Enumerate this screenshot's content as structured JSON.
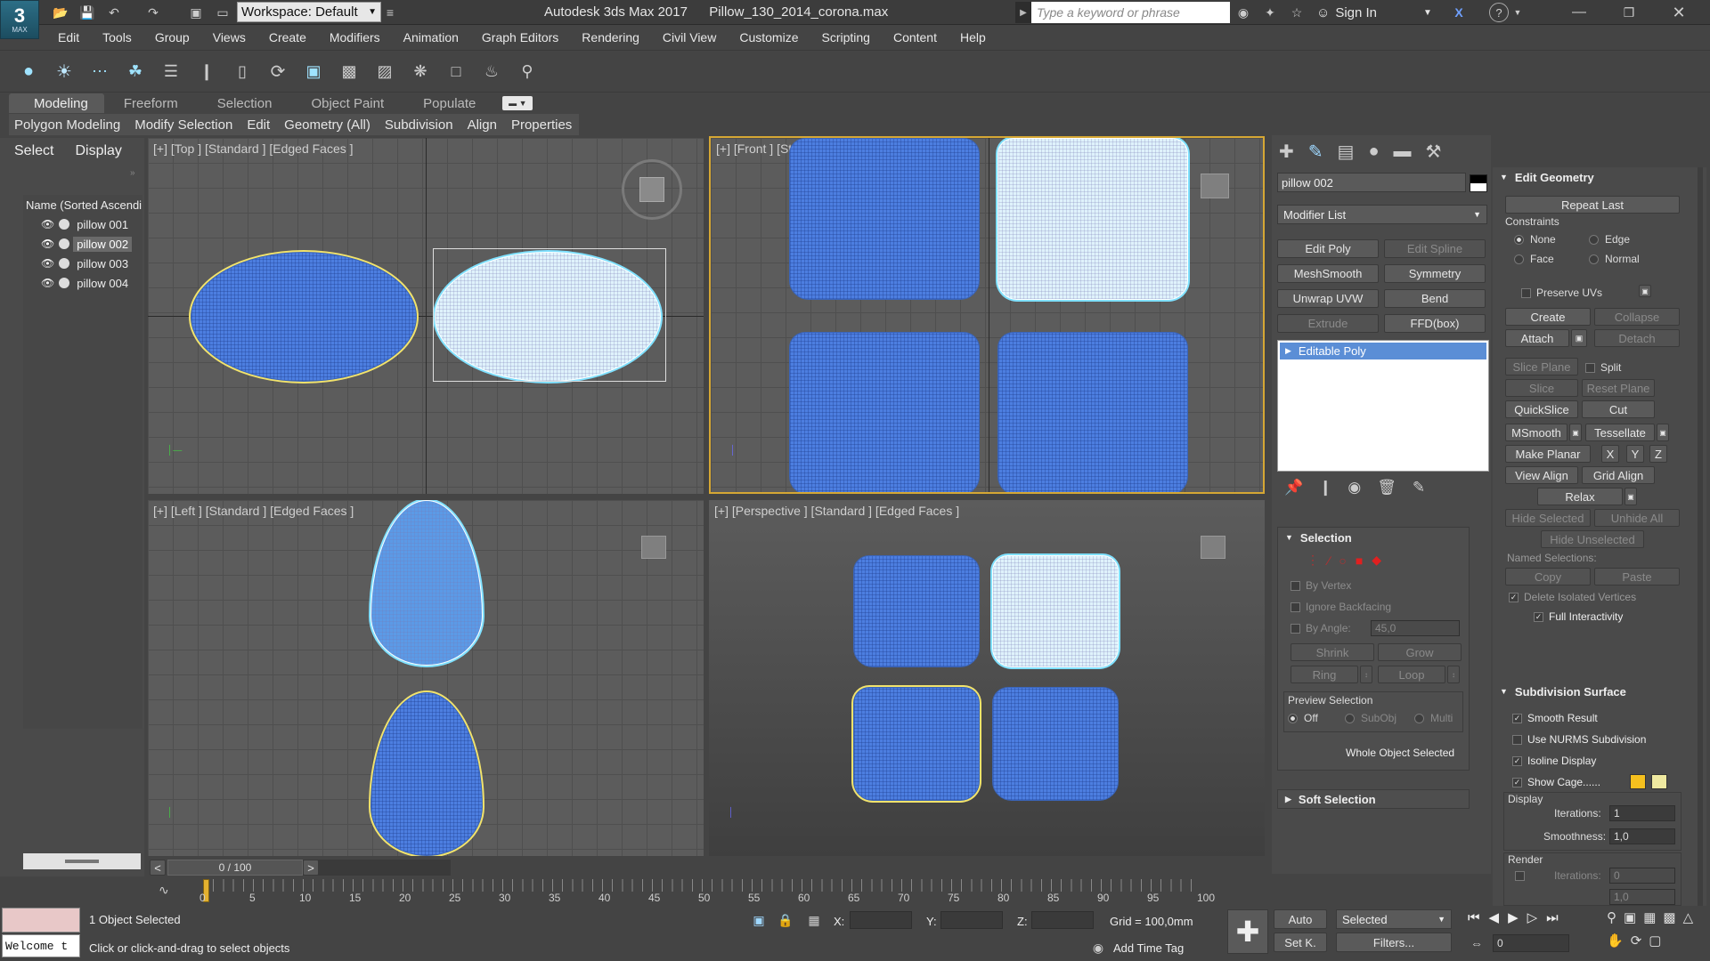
{
  "title_bar": {
    "app_badge": "3",
    "app_badge_sub": "MAX",
    "workspace_label": "Workspace: Default",
    "app_title": "Autodesk 3ds Max 2017",
    "file_name": "Pillow_130_2014_corona.max",
    "search_placeholder": "Type a keyword or phrase",
    "sign_in": "Sign In"
  },
  "menu": [
    "Edit",
    "Tools",
    "Group",
    "Views",
    "Create",
    "Modifiers",
    "Animation",
    "Graph Editors",
    "Rendering",
    "Civil View",
    "Customize",
    "Scripting",
    "Content",
    "Help"
  ],
  "ribbon_tabs": [
    "Modeling",
    "Freeform",
    "Selection",
    "Object Paint",
    "Populate"
  ],
  "ribbon_sub": [
    "Polygon Modeling",
    "Modify Selection",
    "Edit",
    "Geometry (All)",
    "Subdivision",
    "Align",
    "Properties"
  ],
  "scene_explorer": {
    "tabs": [
      "Select",
      "Display"
    ],
    "header": "Name (Sorted Ascendi",
    "items": [
      "pillow 001",
      "pillow 002",
      "pillow 003",
      "pillow 004"
    ],
    "selected_index": 1
  },
  "viewports": {
    "top": "[+] [Top ] [Standard ] [Edged Faces ]",
    "front": "[+] [Front ] [Standard ] [Edged Faces ]",
    "left": "[+] [Left ] [Standard ] [Edged Faces ]",
    "perspective": "[+] [Perspective ] [Standard ] [Edged Faces ]"
  },
  "command_panel": {
    "object_name": "pillow 002",
    "modifier_list": "Modifier List",
    "mod_buttons": [
      {
        "label": "Edit Poly",
        "enabled": true
      },
      {
        "label": "Edit Spline",
        "enabled": false
      },
      {
        "label": "MeshSmooth",
        "enabled": true
      },
      {
        "label": "Symmetry",
        "enabled": true
      },
      {
        "label": "Unwrap UVW",
        "enabled": true
      },
      {
        "label": "Bend",
        "enabled": true
      },
      {
        "label": "Extrude",
        "enabled": false
      },
      {
        "label": "FFD(box)",
        "enabled": true
      }
    ],
    "stack_item": "Editable Poly",
    "selection": {
      "title": "Selection",
      "by_vertex": "By Vertex",
      "ignore_backfacing": "Ignore Backfacing",
      "by_angle": "By Angle:",
      "angle_value": "45,0",
      "shrink": "Shrink",
      "grow": "Grow",
      "ring": "Ring",
      "loop": "Loop",
      "preview_title": "Preview Selection",
      "preview_off": "Off",
      "preview_subobj": "SubObj",
      "preview_multi": "Multi",
      "status": "Whole Object Selected"
    },
    "soft_selection": "Soft Selection"
  },
  "edit_geometry": {
    "title": "Edit Geometry",
    "repeat_last": "Repeat Last",
    "constraints": "Constraints",
    "c_none": "None",
    "c_edge": "Edge",
    "c_face": "Face",
    "c_normal": "Normal",
    "preserve_uvs": "Preserve UVs",
    "create": "Create",
    "collapse": "Collapse",
    "attach": "Attach",
    "detach": "Detach",
    "slice_plane": "Slice Plane",
    "split": "Split",
    "slice": "Slice",
    "reset_plane": "Reset Plane",
    "quickslice": "QuickSlice",
    "cut": "Cut",
    "msmooth": "MSmooth",
    "tessellate": "Tessellate",
    "make_planar": "Make Planar",
    "x": "X",
    "y": "Y",
    "z": "Z",
    "view_align": "View Align",
    "grid_align": "Grid Align",
    "relax": "Relax",
    "hide_selected": "Hide Selected",
    "unhide_all": "Unhide All",
    "hide_unselected": "Hide Unselected",
    "named_selections": "Named Selections:",
    "copy": "Copy",
    "paste": "Paste",
    "delete_isolated": "Delete Isolated Vertices",
    "full_interactivity": "Full Interactivity"
  },
  "subdivision": {
    "title": "Subdivision Surface",
    "smooth_result": "Smooth Result",
    "use_nurms": "Use NURMS Subdivision",
    "isoline": "Isoline Display",
    "show_cage": "Show Cage......",
    "cage_color_1": "#f5c01e",
    "cage_color_2": "#efe9a0",
    "display": "Display",
    "iterations_label": "Iterations:",
    "iterations": "1",
    "smoothness_label": "Smoothness:",
    "smoothness": "1,0",
    "render": "Render",
    "render_iterations": "0",
    "render_smoothness": "1,0"
  },
  "timeline": {
    "frame_display": "0 / 100",
    "ticks": [
      "0",
      "5",
      "10",
      "15",
      "20",
      "25",
      "30",
      "35",
      "40",
      "45",
      "50",
      "55",
      "60",
      "65",
      "70",
      "75",
      "80",
      "85",
      "90",
      "95",
      "100"
    ]
  },
  "status_bar": {
    "selection_status": "1 Object Selected",
    "prompt": "Click or click-and-drag to select objects",
    "maxscript": "Welcome t",
    "x_label": "X:",
    "y_label": "Y:",
    "z_label": "Z:",
    "grid": "Grid = 100,0mm",
    "add_time_tag": "Add Time Tag",
    "auto": "Auto",
    "set_key": "Set K.",
    "selected_dropdown": "Selected",
    "filters": "Filters...",
    "frame_value": "0"
  },
  "colors": {
    "selection_highlight": "#5b8ed6",
    "selected_object_outline": "#ffffff",
    "pillow_blue": "#4c7ee0"
  }
}
